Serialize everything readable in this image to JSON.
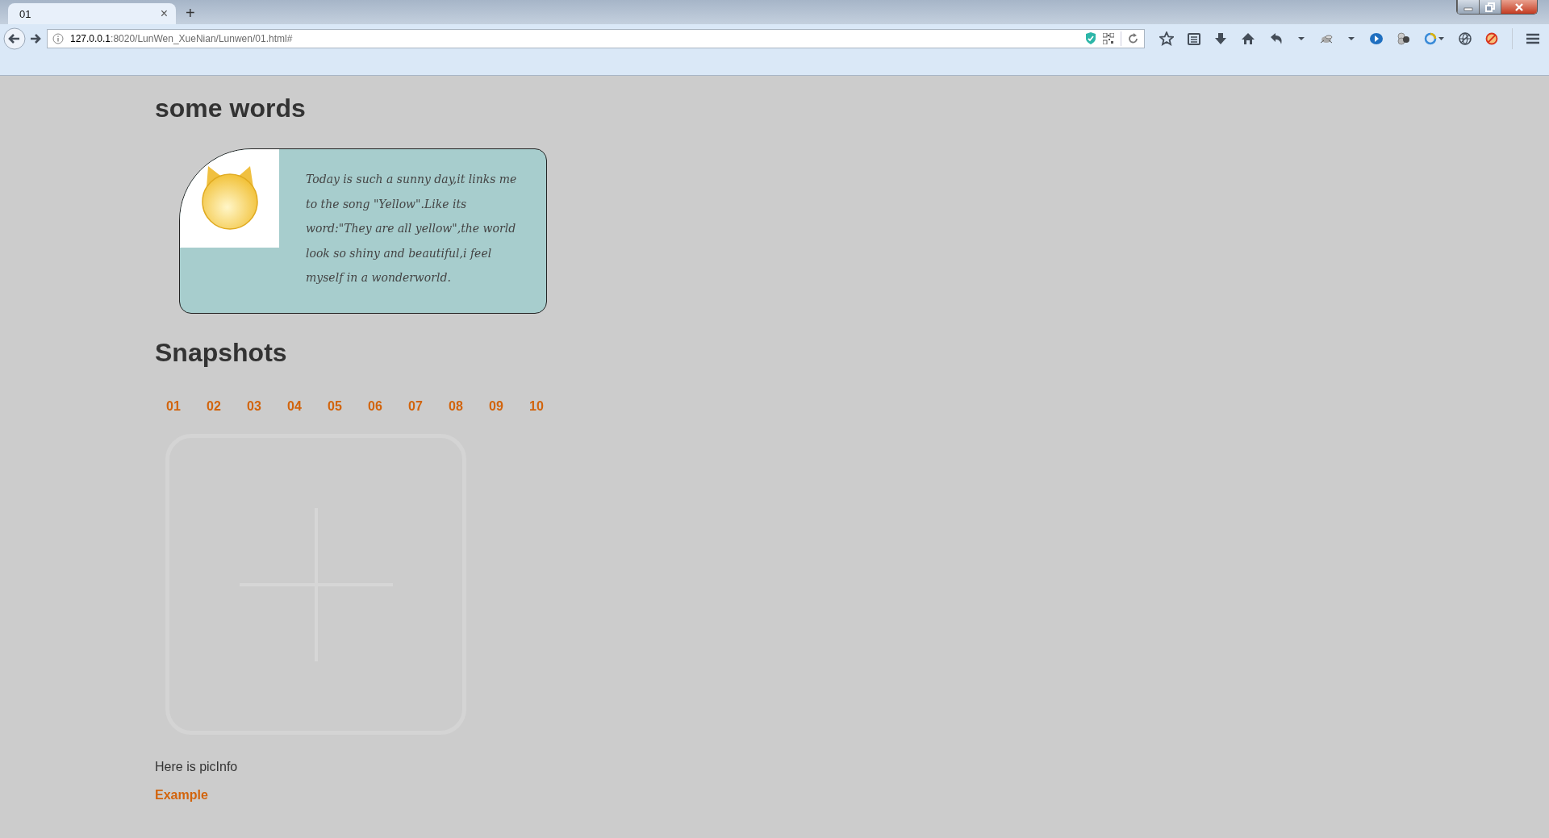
{
  "browser": {
    "tab": {
      "title": "01",
      "close": "×",
      "selected": true
    },
    "new_tab": "+",
    "url": {
      "host": "127.0.0.1",
      "rest": ":8020/LunWen_XueNian/Lunwen/01.html#"
    }
  },
  "page": {
    "intro": {
      "heading": "some words",
      "text": "Today is such a sunny day,it links me to the song \"Yellow\".Like its word:\"They are all yellow\",the world look so shiny and beautiful,i feel myself in a wonderworld."
    },
    "snapshots": {
      "heading": "Snapshots",
      "links": [
        "01",
        "02",
        "03",
        "04",
        "05",
        "06",
        "07",
        "08",
        "09",
        "10"
      ],
      "caption": "Here is picInfo",
      "example_link": "Example"
    }
  }
}
